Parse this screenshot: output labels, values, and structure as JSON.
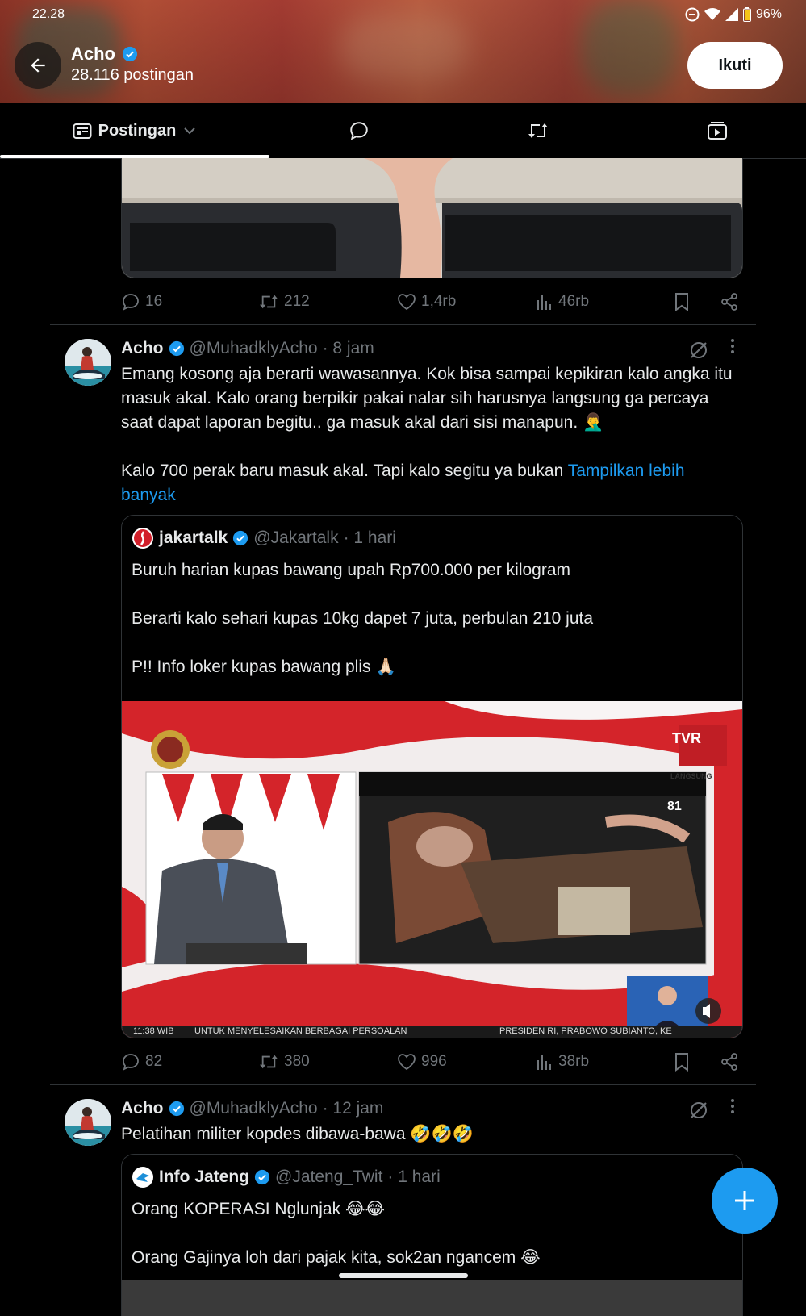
{
  "status_bar": {
    "time": "22.28",
    "battery": "96%"
  },
  "header": {
    "name": "Acho",
    "post_count": "28.116 postingan",
    "follow_label": "Ikuti"
  },
  "tabs": [
    {
      "label": "Postingan"
    }
  ],
  "posts": [
    {
      "stats": {
        "replies": "16",
        "reposts": "212",
        "likes": "1,4rb",
        "views": "46rb"
      }
    },
    {
      "name": "Acho",
      "handle": "@MuhadklyAcho",
      "time": "· 8 jam",
      "text_p1": "Emang kosong aja berarti wawasannya. Kok bisa sampai kepikiran kalo angka itu masuk akal. Kalo orang berpikir pakai nalar sih harusnya langsung ga percaya saat dapat laporan begitu.. ga masuk akal dari sisi manapun. 🤦‍♂️",
      "text_p2": "Kalo 700 perak baru masuk akal. Tapi kalo segitu ya bukan ",
      "show_more": "Tampilkan lebih banyak",
      "quote": {
        "name": "jakartalk",
        "handle": "@Jakartalk",
        "time": "· 1 hari",
        "line1": "Buruh harian kupas bawang upah Rp700.000 per kilogram",
        "line2": "Berarti kalo sehari kupas 10kg dapet 7 juta, perbulan 210 juta",
        "line3": "P!! Info loker kupas bawang plis 🙏🏻",
        "video": {
          "logo": "TVR",
          "live": "LANGSUNG",
          "channel": "81",
          "ticker_time": "11:38 WIB",
          "ticker": "UNTUK MENYELESAIKAN BERBAGAI PERSOALAN",
          "ticker2": "PRESIDEN RI, PRABOWO SUBIANTO, KE"
        }
      },
      "stats": {
        "replies": "82",
        "reposts": "380",
        "likes": "996",
        "views": "38rb"
      }
    },
    {
      "name": "Acho",
      "handle": "@MuhadklyAcho",
      "time": "· 12 jam",
      "text": "Pelatihan militer kopdes dibawa-bawa 🤣🤣🤣",
      "quote": {
        "name": "Info Jateng",
        "handle": "@Jateng_Twit",
        "time": "· 1 hari",
        "line1": "Orang KOPERASI Nglunjak 😂😂",
        "line2": "Orang Gajinya loh dari pajak kita, sok2an ngancem 😂"
      }
    }
  ],
  "colors": {
    "accent": "#1d9bf0",
    "muted": "#71767b",
    "text": "#e7e9ea",
    "border": "#2f3336"
  }
}
